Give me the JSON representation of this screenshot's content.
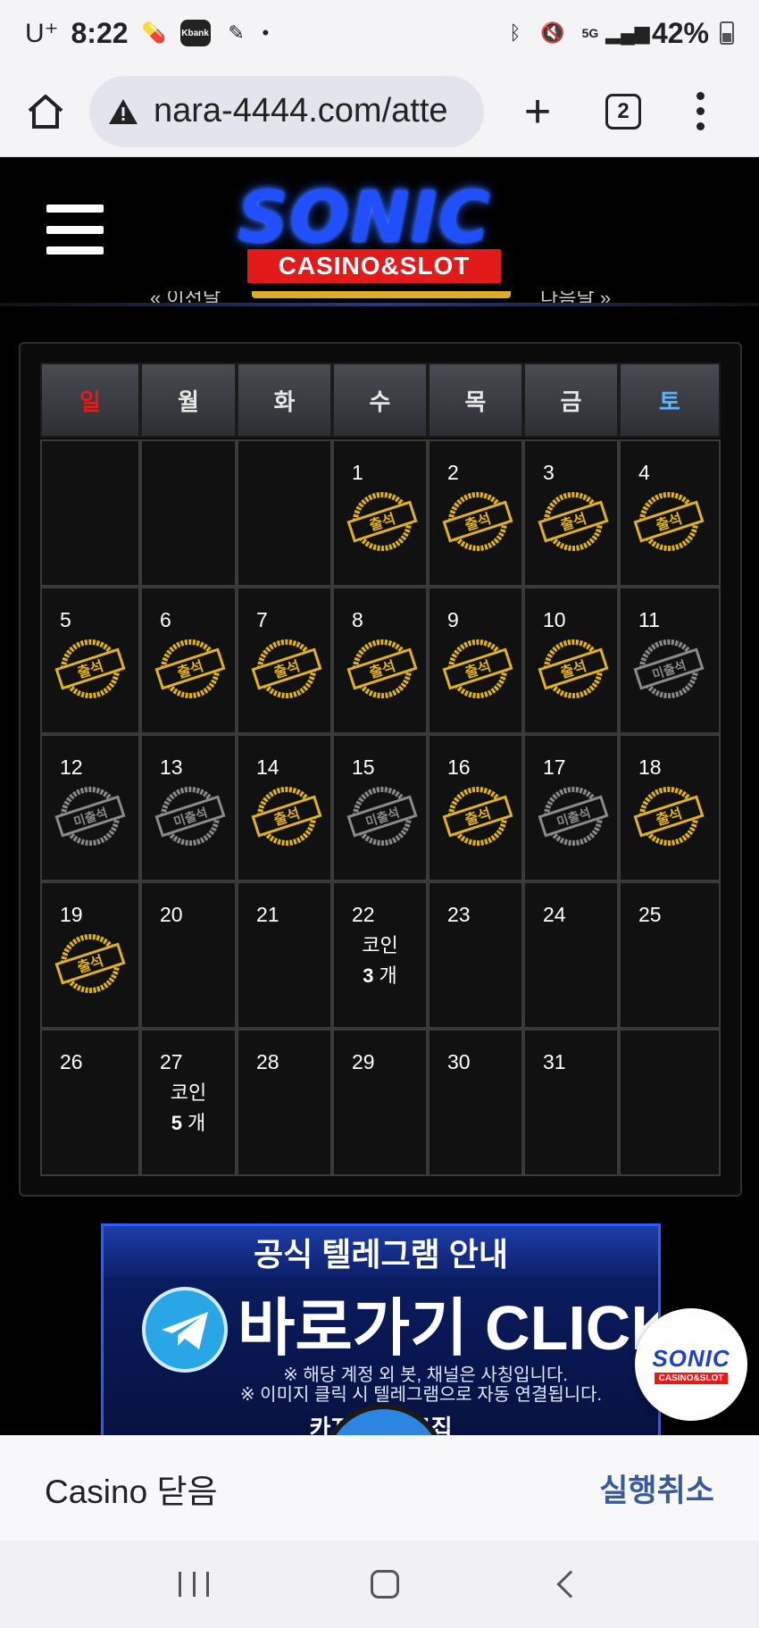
{
  "status_bar": {
    "carrier": "U⁺",
    "time": "8:22",
    "kbank_label": "Kbank",
    "network": "5G",
    "battery": "42%"
  },
  "browser": {
    "url": "nara-4444.com/atte",
    "tab_count": "2"
  },
  "site": {
    "logo_main": "SONIC",
    "logo_sub": "CASINO&SLOT",
    "calendar_prev_label": "« 이전달",
    "calendar_next_label": "다음달 »"
  },
  "calendar": {
    "weekdays": [
      "일",
      "월",
      "화",
      "수",
      "목",
      "금",
      "토"
    ],
    "stamp_attend": "출석",
    "stamp_absent": "미출석",
    "coin_label": "코인",
    "coin_unit": "개",
    "rows": [
      [
        {
          "d": ""
        },
        {
          "d": ""
        },
        {
          "d": ""
        },
        {
          "d": "1",
          "s": "attend"
        },
        {
          "d": "2",
          "s": "attend"
        },
        {
          "d": "3",
          "s": "attend"
        },
        {
          "d": "4",
          "s": "attend"
        }
      ],
      [
        {
          "d": "5",
          "s": "attend"
        },
        {
          "d": "6",
          "s": "attend"
        },
        {
          "d": "7",
          "s": "attend"
        },
        {
          "d": "8",
          "s": "attend"
        },
        {
          "d": "9",
          "s": "attend"
        },
        {
          "d": "10",
          "s": "attend"
        },
        {
          "d": "11",
          "s": "absent"
        }
      ],
      [
        {
          "d": "12",
          "s": "absent"
        },
        {
          "d": "13",
          "s": "absent"
        },
        {
          "d": "14",
          "s": "attend"
        },
        {
          "d": "15",
          "s": "absent"
        },
        {
          "d": "16",
          "s": "attend"
        },
        {
          "d": "17",
          "s": "absent"
        },
        {
          "d": "18",
          "s": "attend"
        }
      ],
      [
        {
          "d": "19",
          "s": "attend"
        },
        {
          "d": "20"
        },
        {
          "d": "21"
        },
        {
          "d": "22",
          "coin": "3"
        },
        {
          "d": "23"
        },
        {
          "d": "24"
        },
        {
          "d": "25"
        }
      ],
      [
        {
          "d": "26"
        },
        {
          "d": "27",
          "coin": "5"
        },
        {
          "d": "28"
        },
        {
          "d": "29"
        },
        {
          "d": "30"
        },
        {
          "d": "31"
        },
        {
          "d": ""
        }
      ]
    ]
  },
  "banner": {
    "title": "공식 텔레그램 안내",
    "cta": "바로가기 CLICK",
    "note1": "※ 해당 계정 외 봇, 채널은 사칭입니다.",
    "note2": "※ 이미지 클릭 시 텔레그램으로 자동 연결됩니다.",
    "bottom": "카지노 … 모집"
  },
  "fab": {
    "main": "SONIC",
    "sub": "CASINO&SLOT"
  },
  "snackbar": {
    "message": "Casino 닫음",
    "action": "실행취소"
  },
  "colors": {
    "gold": "#e0b21f",
    "absent_gray": "#8a8a8a",
    "sunday": "#e21a1a",
    "saturday": "#5ab4ff",
    "brand_blue": "#1f4fff"
  }
}
